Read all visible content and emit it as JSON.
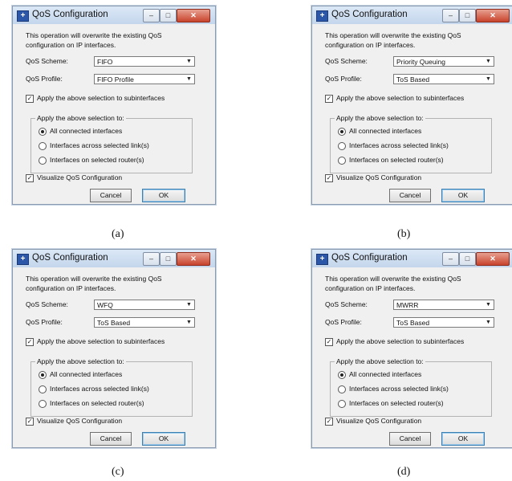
{
  "dialogs": [
    {
      "title": "QoS Configuration",
      "description": "This operation will overwrite the existing QoS configuration on IP interfaces.",
      "scheme_label": "QoS Scheme:",
      "scheme_value": "FIFO",
      "profile_label": "QoS Profile:",
      "profile_value": "FIFO Profile",
      "subinterfaces_label": "Apply the above selection to subinterfaces",
      "group_title": "Apply the above selection to:",
      "radio_all": "All connected interfaces",
      "radio_links": "Interfaces across selected link(s)",
      "radio_routers": "Interfaces on selected router(s)",
      "visualize_label": "Visualize QoS Configuration",
      "cancel": "Cancel",
      "ok": "OK",
      "caption": "(a)"
    },
    {
      "title": "QoS Configuration",
      "description": "This operation will overwrite the existing QoS configuration on IP interfaces.",
      "scheme_label": "QoS Scheme:",
      "scheme_value": "Priority Queuing",
      "profile_label": "QoS Profile:",
      "profile_value": "ToS Based",
      "subinterfaces_label": "Apply the above selection to subinterfaces",
      "group_title": "Apply the above selection to:",
      "radio_all": "All connected interfaces",
      "radio_links": "Interfaces across selected link(s)",
      "radio_routers": "Interfaces on selected router(s)",
      "visualize_label": "Visualize QoS Configuration",
      "cancel": "Cancel",
      "ok": "OK",
      "caption": "(b)"
    },
    {
      "title": "QoS Configuration",
      "description": "This operation will overwrite the existing QoS configuration on IP interfaces.",
      "scheme_label": "QoS Scheme:",
      "scheme_value": "WFQ",
      "profile_label": "QoS Profile:",
      "profile_value": "ToS Based",
      "subinterfaces_label": "Apply the above selection to subinterfaces",
      "group_title": "Apply the above selection to:",
      "radio_all": "All connected interfaces",
      "radio_links": "Interfaces across selected link(s)",
      "radio_routers": "Interfaces on selected router(s)",
      "visualize_label": "Visualize QoS Configuration",
      "cancel": "Cancel",
      "ok": "OK",
      "caption": "(c)"
    },
    {
      "title": "QoS Configuration",
      "description": "This operation will overwrite the existing QoS configuration on IP interfaces.",
      "scheme_label": "QoS Scheme:",
      "scheme_value": "MWRR",
      "profile_label": "QoS Profile:",
      "profile_value": "ToS Based",
      "subinterfaces_label": "Apply the above selection to subinterfaces",
      "group_title": "Apply the above selection to:",
      "radio_all": "All connected interfaces",
      "radio_links": "Interfaces across selected link(s)",
      "radio_routers": "Interfaces on selected router(s)",
      "visualize_label": "Visualize QoS Configuration",
      "cancel": "Cancel",
      "ok": "OK",
      "caption": "(d)"
    }
  ],
  "colors": {
    "titlebar": "#c4d6ec",
    "close_button": "#c8432c",
    "dialog_bg": "#f0f0f0"
  }
}
